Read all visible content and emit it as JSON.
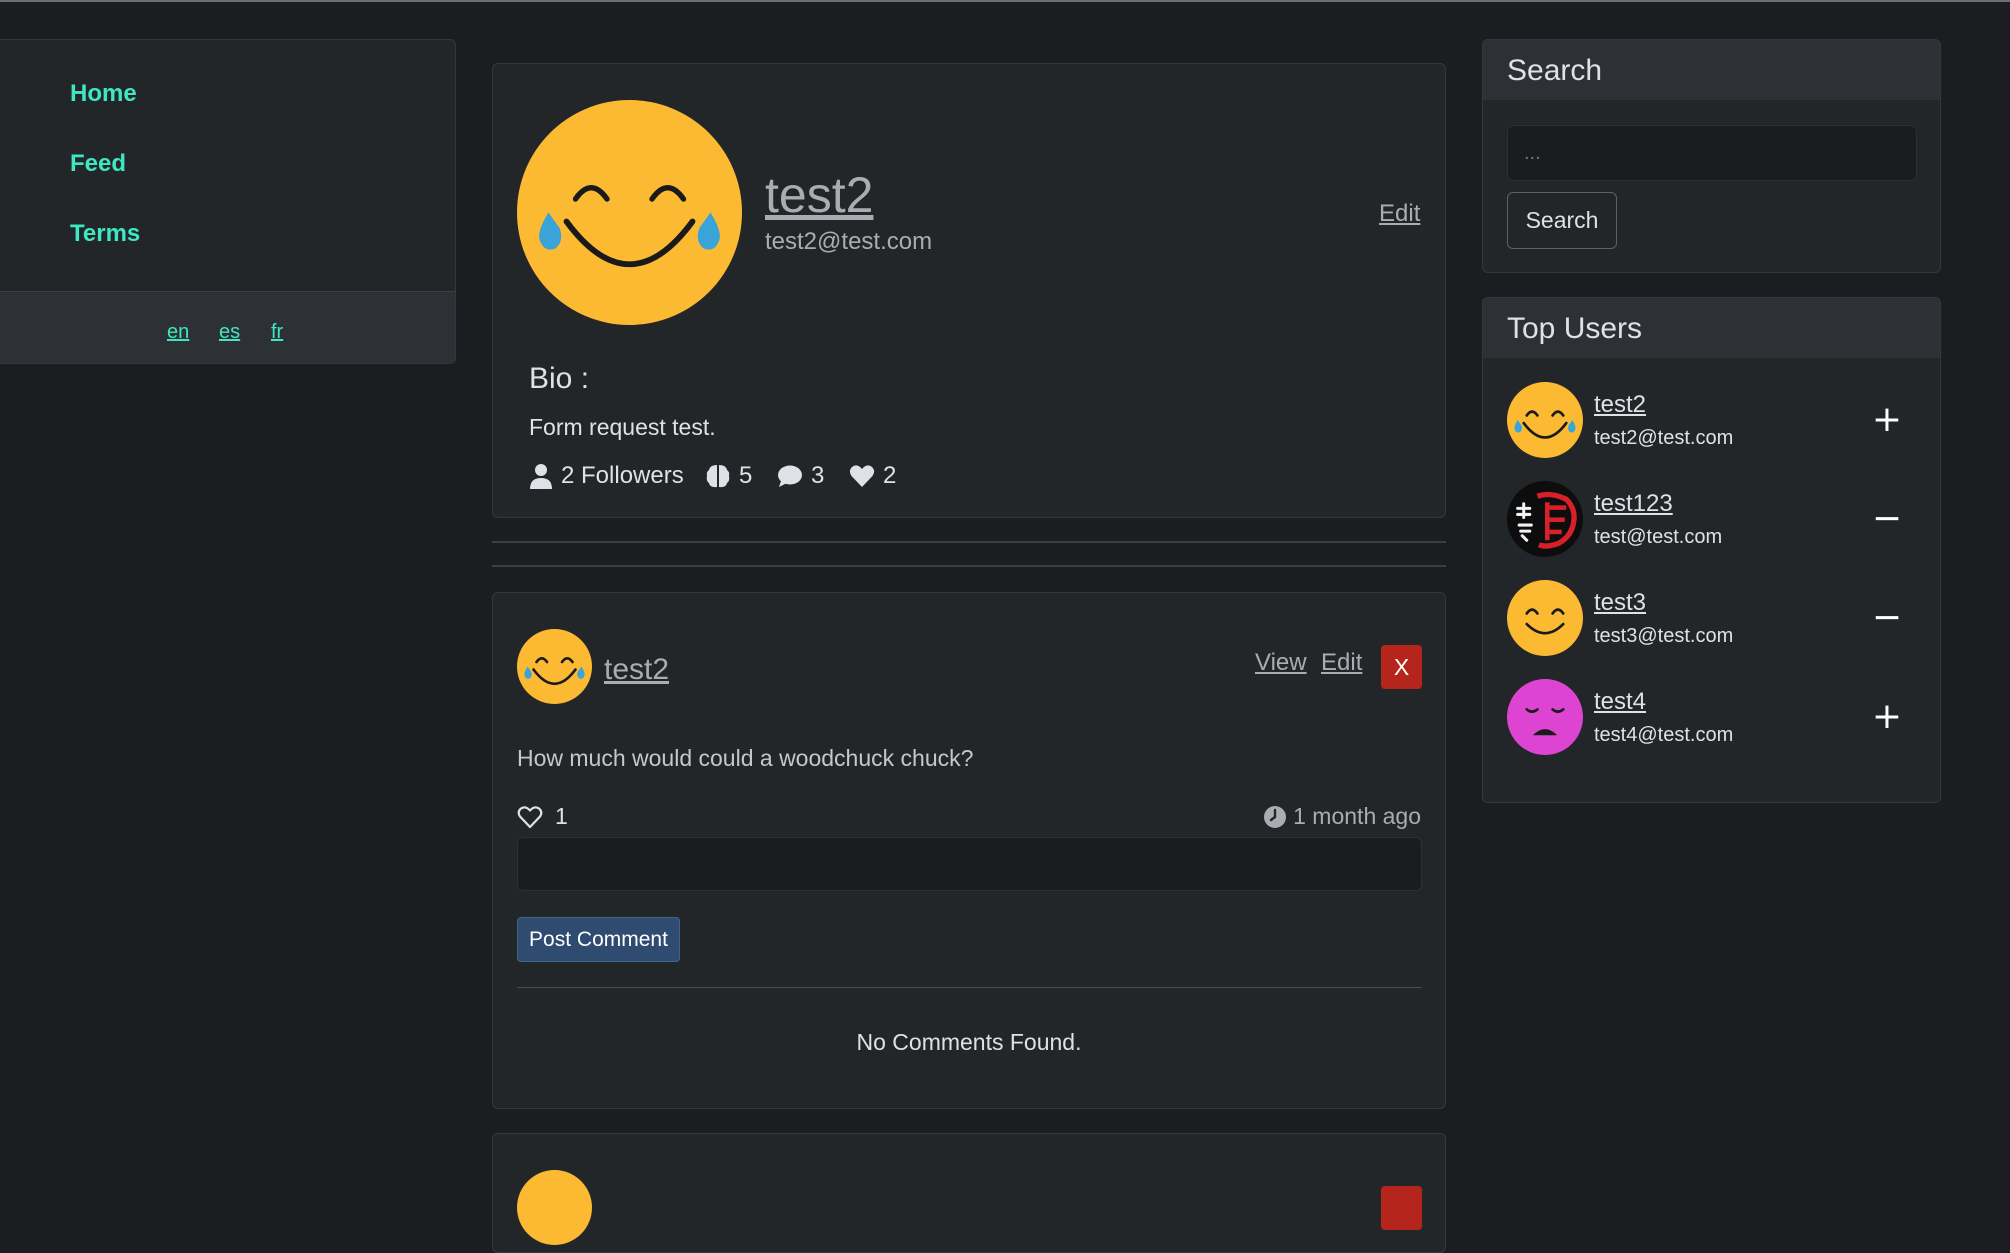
{
  "nav": {
    "home": "Home",
    "feed": "Feed",
    "terms": "Terms"
  },
  "languages": [
    "en",
    "es",
    "fr"
  ],
  "profile": {
    "username": "test2",
    "email": "test2@test.com",
    "edit_label": "Edit",
    "bio_label": "Bio :",
    "bio_text": "Form request test.",
    "followers_label": "2 Followers",
    "posts_count": "5",
    "comments_count": "3",
    "likes_count": "2"
  },
  "post": {
    "username": "test2",
    "view_label": "View",
    "edit_label": "Edit",
    "delete_label": "X",
    "body": "How much would could a woodchuck chuck?",
    "likes": "1",
    "time": "1 month ago",
    "comment_placeholder": "",
    "post_comment_label": "Post Comment",
    "no_comments": "No Comments Found."
  },
  "search": {
    "title": "Search",
    "placeholder": "...",
    "button_label": "Search"
  },
  "top_users": {
    "title": "Top Users",
    "users": [
      {
        "name": "test2",
        "email": "test2@test.com",
        "action": "+"
      },
      {
        "name": "test123",
        "email": "test@test.com",
        "action": "−"
      },
      {
        "name": "test3",
        "email": "test3@test.com",
        "action": "−"
      },
      {
        "name": "test4",
        "email": "test4@test.com",
        "action": "+"
      }
    ]
  },
  "colors": {
    "background": "#1b1d20",
    "card": "#232629",
    "accent_link": "#3ee6c1",
    "danger": "#b5251c",
    "primary_button": "#2f4b70",
    "emoji_yellow": "#fcba33",
    "emoji_pink": "#dd44d2"
  },
  "icons": {
    "profile_avatar": "laughing-tears-emoji",
    "followers": "user-icon",
    "posts": "brain-icon",
    "comments": "speech-bubble-icon",
    "likes": "heart-icon",
    "time": "clock-icon"
  }
}
